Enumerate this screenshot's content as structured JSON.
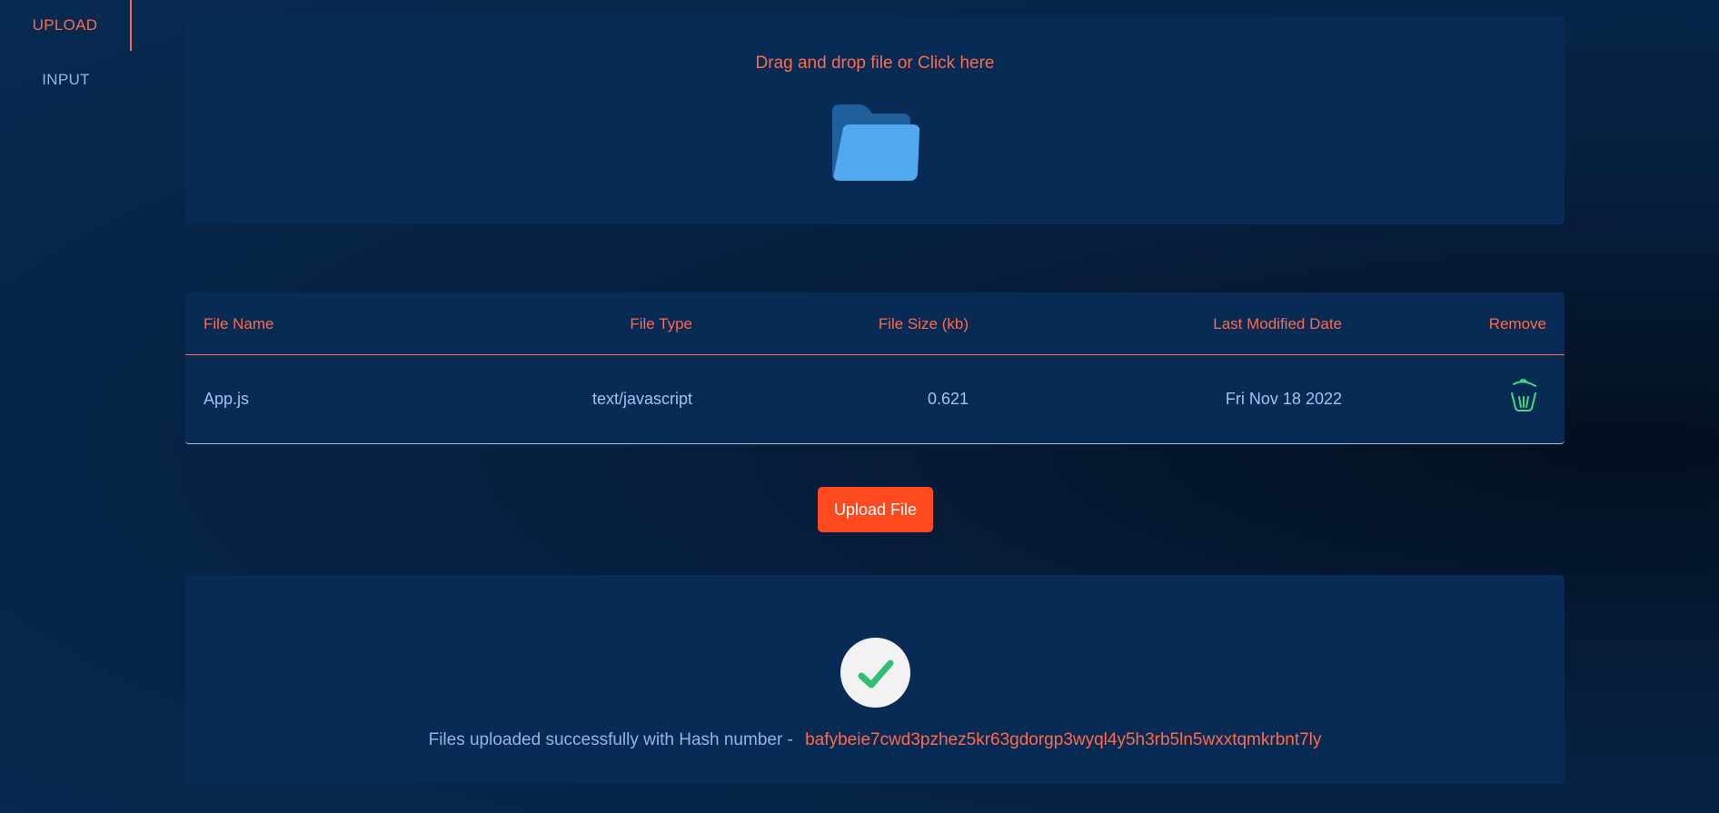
{
  "sidebar": {
    "tabs": [
      {
        "label": "UPLOAD",
        "active": true
      },
      {
        "label": "INPUT",
        "active": false
      }
    ]
  },
  "dropzone": {
    "text": "Drag and drop file or Click here",
    "icon": "folder-icon"
  },
  "table": {
    "headers": {
      "name": "File Name",
      "type": "File Type",
      "size": "File Size (kb)",
      "date": "Last Modified Date",
      "remove": "Remove"
    },
    "rows": [
      {
        "name": "App.js",
        "type": "text/javascript",
        "size": "0.621",
        "date": "Fri Nov 18 2022",
        "remove_icon": "trash-icon"
      }
    ]
  },
  "upload_button": {
    "label": "Upload File"
  },
  "success": {
    "icon": "check-icon",
    "message": "Files uploaded successfully with Hash number -",
    "hash": "bafybeie7cwd3pzhez5kr63gdorgp3wyql4y5h3rb5ln5wxxtqmkrbnt7ly"
  },
  "colors": {
    "accent": "#ff6a4c",
    "button": "#ff4a1f",
    "panel": "#072b55",
    "text": "#9cc6f0",
    "success_check": "#2fbf71",
    "trash_icon": "#3ddc84"
  }
}
